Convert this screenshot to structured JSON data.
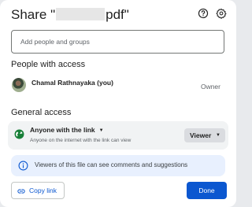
{
  "dialog": {
    "title_prefix": "Share \"",
    "title_suffix": "pdf\"",
    "icons": [
      "help-icon",
      "settings-icon"
    ]
  },
  "add_people": {
    "placeholder": "Add people and groups"
  },
  "people_with_access": {
    "heading": "People with access",
    "people": [
      {
        "name": "Chamal Rathnayaka (you)",
        "role": "Owner"
      }
    ]
  },
  "general_access": {
    "heading": "General access",
    "setting": "Anyone with the link",
    "description": "Anyone on the internet with the link can view",
    "role": "Viewer",
    "icon": "globe-icon"
  },
  "info": {
    "text": "Viewers of this file can see comments and suggestions",
    "icon": "info-icon"
  },
  "actions": {
    "copy_link": "Copy link",
    "done": "Done"
  },
  "colors": {
    "primary": "#0b57d0",
    "info_bg": "#e8f0fe",
    "access_bg": "#f1f3f4",
    "globe_green": "#188038"
  }
}
